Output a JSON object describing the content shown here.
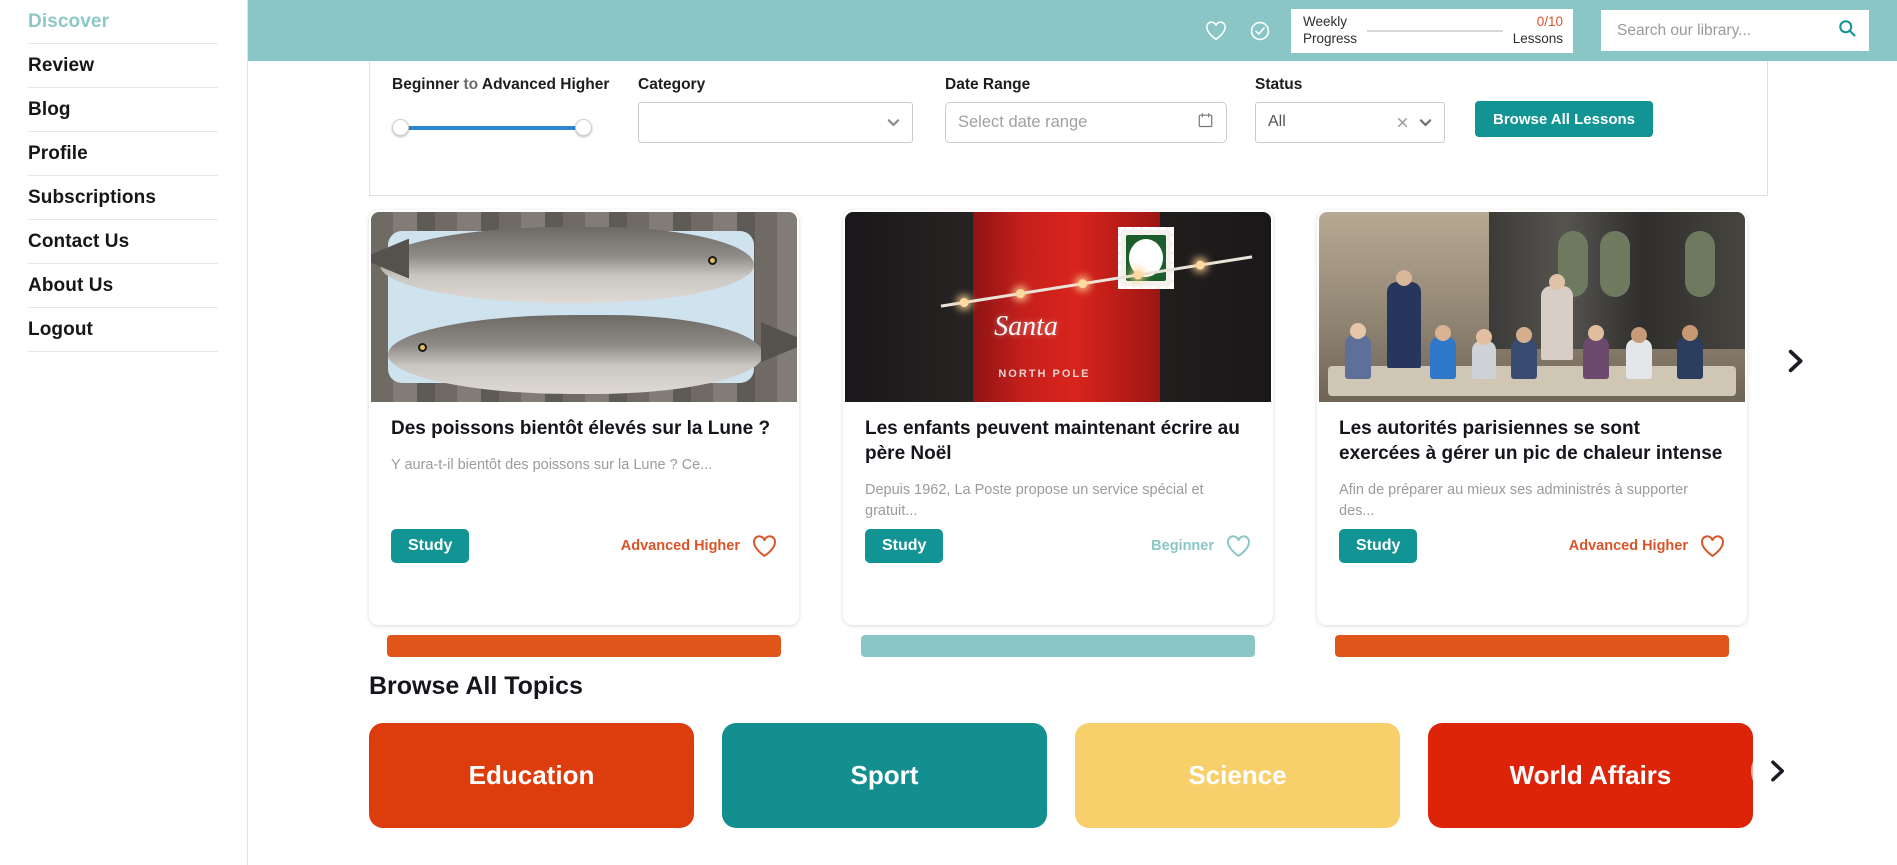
{
  "sidebar": {
    "items": [
      {
        "label": "Discover",
        "active": true
      },
      {
        "label": "Review",
        "active": false
      },
      {
        "label": "Blog",
        "active": false
      },
      {
        "label": "Profile",
        "active": false
      },
      {
        "label": "Subscriptions",
        "active": false
      },
      {
        "label": "Contact Us",
        "active": false
      },
      {
        "label": "About Us",
        "active": false
      },
      {
        "label": "Logout",
        "active": false
      }
    ]
  },
  "header": {
    "background_color": "#8bc6c6",
    "favourites_icon": "heart-icon",
    "completed_icon": "check-circle-icon",
    "progress": {
      "label_line1": "Weekly",
      "label_line2": "Progress",
      "count": "0/10",
      "unit": "Lessons",
      "count_color": "#d8552a",
      "percent": 0
    },
    "search": {
      "placeholder": "Search our library...",
      "value": "",
      "icon": "search-icon",
      "icon_color": "#139494"
    }
  },
  "filters": {
    "level": {
      "label_prefix": "Beginner",
      "label_mid": "to",
      "label_suffix": "Advanced Higher",
      "full_label": "Beginner to Advanced Higher",
      "slider_color": "#2f86d0",
      "min_value": "Beginner",
      "max_value": "Advanced Higher"
    },
    "category": {
      "label": "Category",
      "value": "",
      "placeholder": "",
      "chevron_icon": "chevron-down-icon"
    },
    "date_range": {
      "label": "Date Range",
      "placeholder": "Select date range",
      "value": "",
      "icon": "calendar-icon"
    },
    "status": {
      "label": "Status",
      "value": "All",
      "clear_icon": "close-icon",
      "chevron_icon": "chevron-down-icon"
    },
    "browse_button": {
      "label": "Browse All Lessons",
      "color": "#139494"
    }
  },
  "lessons": {
    "next_arrow_icon": "chevron-right-icon",
    "cards": [
      {
        "title": "Des poissons bientôt élevés sur la Lune ?",
        "description": "Y aura-t-il bientôt des poissons sur la Lune ? Ce...",
        "study_label": "Study",
        "level": "Advanced Higher",
        "level_color": "#d8552a",
        "bar_color": "#e0561a",
        "favourite_icon": "heart-icon",
        "image_alt": "two trout fish on a blue plate"
      },
      {
        "title": "Les enfants peuvent maintenant écrire au père Noël",
        "description": "Depuis 1962, La Poste propose un service spécial et gratuit...",
        "study_label": "Study",
        "level": "Beginner",
        "level_color": "#8bc6c6",
        "bar_color": "#8bc6c6",
        "favourite_icon": "heart-icon",
        "image_alt": "red Santa post box with festive lights"
      },
      {
        "title": "Les autorités parisiennes se sont exercées à gérer un pic de chaleur intense",
        "description": "Afin de préparer au mieux ses administrés à supporter des...",
        "study_label": "Study",
        "level": "Advanced Higher",
        "level_color": "#d8552a",
        "bar_color": "#e0561a",
        "favourite_icon": "heart-icon",
        "image_alt": "children eating in a school canteen"
      }
    ]
  },
  "topics": {
    "title": "Browse All Topics",
    "next_arrow_icon": "chevron-right-icon",
    "tiles": [
      {
        "label": "Education",
        "color": "#dd3c0c"
      },
      {
        "label": "Sport",
        "color": "#138f8f"
      },
      {
        "label": "Science",
        "color": "#f7cf6b"
      },
      {
        "label": "World Affairs",
        "color": "#dd2409"
      }
    ]
  }
}
